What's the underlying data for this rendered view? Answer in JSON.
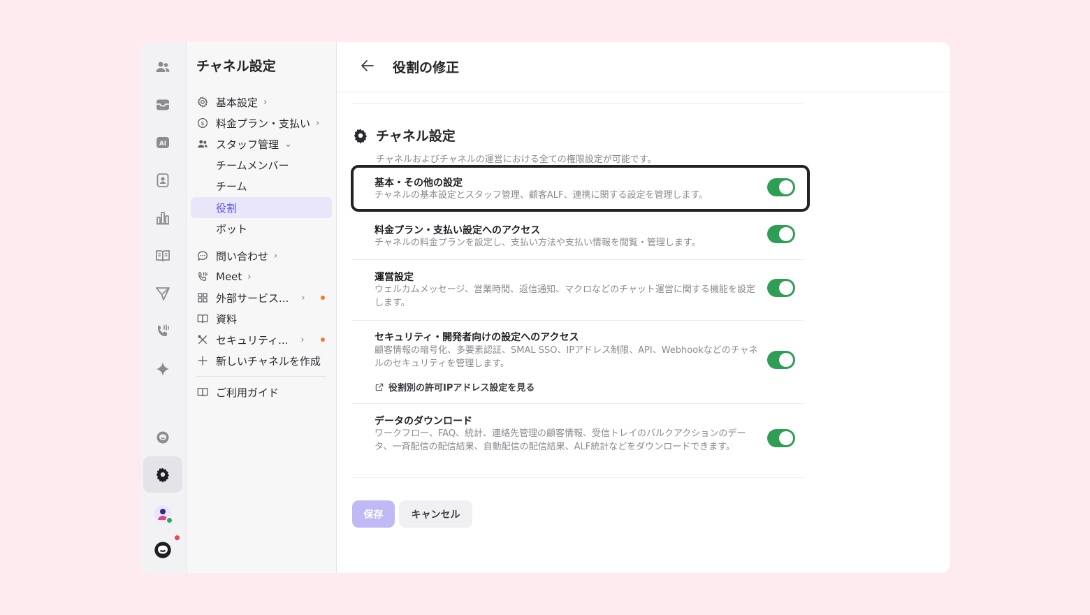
{
  "menu": {
    "title": "チャネル設定",
    "items": [
      {
        "label": "基本設定",
        "chevron": "›"
      },
      {
        "label": "料金プラン・支払い",
        "chevron": "›"
      },
      {
        "label": "スタッフ管理",
        "chevron": "⌄"
      },
      {
        "label": "チームメンバー"
      },
      {
        "label": "チーム"
      },
      {
        "label": "役割"
      },
      {
        "label": "ボット"
      },
      {
        "label": "問い合わせ",
        "chevron": "›"
      },
      {
        "label": "Meet",
        "chevron": "›"
      },
      {
        "label": "外部サービス...",
        "chevron": "›"
      },
      {
        "label": "資料"
      },
      {
        "label": "セキュリティ...",
        "chevron": "›"
      },
      {
        "label": "新しいチャネルを作成"
      },
      {
        "label": "ご利用ガイド"
      }
    ]
  },
  "header": {
    "title": "役割の修正"
  },
  "section": {
    "title": "チャネル設定",
    "description": "チャネルおよびチャネルの運営における全ての権限設定が可能です。"
  },
  "permissions": [
    {
      "title": "基本・その他の設定",
      "description": "チャネルの基本設定とスタッフ管理、顧客ALF、連携に関する設定を管理します。",
      "enabled": true
    },
    {
      "title": "料金プラン・支払い設定へのアクセス",
      "description": "チャネルの料金プランを設定し、支払い方法や支払い情報を閲覧・管理します。",
      "enabled": true
    },
    {
      "title": "運営設定",
      "description": "ウェルカムメッセージ、営業時間、返信通知、マクロなどのチャット運営に関する機能を設定します。",
      "enabled": true
    },
    {
      "title": "セキュリティ・開発者向けの設定へのアクセス",
      "description": "顧客情報の暗号化、多要素認証、SMAL SSO、IPアドレス制限、API、Webhookなどのチャネルのセキュリティを管理します。",
      "link": "役割別の許可IPアドレス設定を見る",
      "enabled": true
    },
    {
      "title": "データのダウンロード",
      "description": "ワークフロー、FAQ、統計、連絡先管理の顧客情報、受信トレイのバルクアクションのデータ、一斉配信の配信結果、自動配信の配信結果、ALF統計などをダウンロードできます。",
      "enabled": true
    }
  ],
  "actions": {
    "save": "保存",
    "cancel": "キャンセル"
  },
  "colors": {
    "accent": "#5e56f0",
    "toggle_on": "#2f9e55",
    "save_disabled": "#bfbaf6"
  }
}
